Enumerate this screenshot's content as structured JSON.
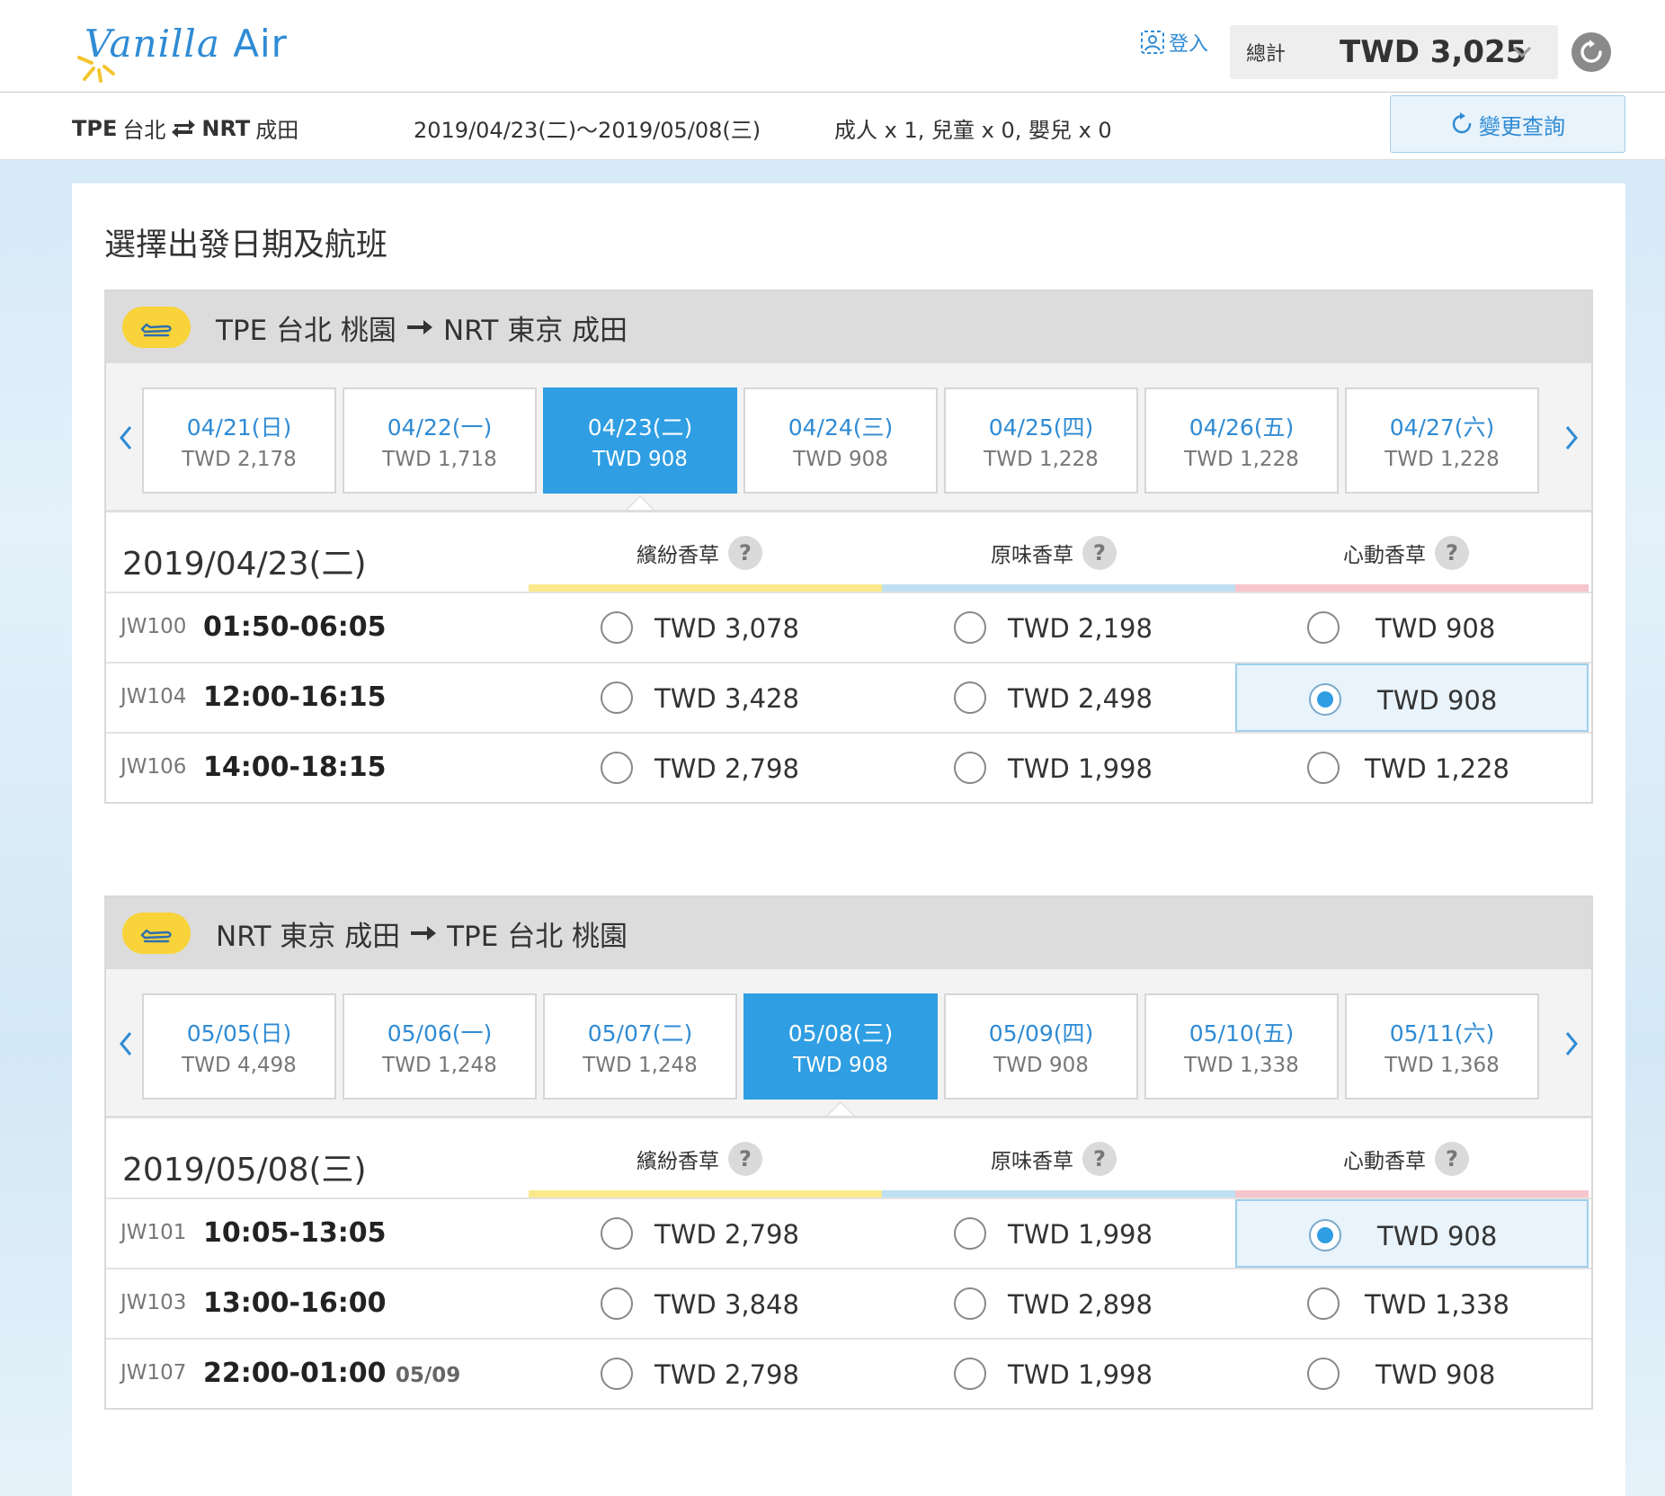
{
  "brand": {
    "name": "Vanilla Air",
    "word": "Vanilla",
    "word2": " Air"
  },
  "header": {
    "login_label": "登入",
    "total_label": "總計",
    "total_value": "TWD 3,025"
  },
  "summary": {
    "origin_code": "TPE",
    "origin_city": "台北",
    "dest_code": "NRT",
    "dest_city": "成田",
    "dates": "2019/04/23(二)～2019/05/08(三)",
    "passengers": "成人 x 1,  兒童 x 0,  嬰兒 x 0",
    "modify_label": "變更查詢"
  },
  "page_title": "選擇出發日期及航班",
  "fare_types": [
    {
      "name": "繽紛香草",
      "color": "#fbe98c"
    },
    {
      "name": "原味香草",
      "color": "#bfe0f2"
    },
    {
      "name": "心動香草",
      "color": "#f7c5cc"
    }
  ],
  "legs": [
    {
      "title_from": "TPE  台北 桃園",
      "title_to": "NRT  東京 成田",
      "selected_date": "2019/04/23(二)",
      "dates": [
        {
          "date": "04/21(日)",
          "price": "TWD 2,178",
          "selected": false
        },
        {
          "date": "04/22(一)",
          "price": "TWD 1,718",
          "selected": false
        },
        {
          "date": "04/23(二)",
          "price": "TWD 908",
          "selected": true
        },
        {
          "date": "04/24(三)",
          "price": "TWD 908",
          "selected": false
        },
        {
          "date": "04/25(四)",
          "price": "TWD 1,228",
          "selected": false
        },
        {
          "date": "04/26(五)",
          "price": "TWD 1,228",
          "selected": false
        },
        {
          "date": "04/27(六)",
          "price": "TWD 1,228",
          "selected": false
        }
      ],
      "flights": [
        {
          "no": "JW100",
          "time": "01:50-06:05",
          "next": "",
          "fares": [
            "TWD 3,078",
            "TWD 2,198",
            "TWD 908"
          ],
          "selected": -1
        },
        {
          "no": "JW104",
          "time": "12:00-16:15",
          "next": "",
          "fares": [
            "TWD 3,428",
            "TWD 2,498",
            "TWD 908"
          ],
          "selected": 2
        },
        {
          "no": "JW106",
          "time": "14:00-18:15",
          "next": "",
          "fares": [
            "TWD 2,798",
            "TWD 1,998",
            "TWD 1,228"
          ],
          "selected": -1
        }
      ]
    },
    {
      "title_from": "NRT  東京 成田",
      "title_to": "TPE  台北 桃園",
      "selected_date": "2019/05/08(三)",
      "dates": [
        {
          "date": "05/05(日)",
          "price": "TWD 4,498",
          "selected": false
        },
        {
          "date": "05/06(一)",
          "price": "TWD 1,248",
          "selected": false
        },
        {
          "date": "05/07(二)",
          "price": "TWD 1,248",
          "selected": false
        },
        {
          "date": "05/08(三)",
          "price": "TWD 908",
          "selected": true
        },
        {
          "date": "05/09(四)",
          "price": "TWD 908",
          "selected": false
        },
        {
          "date": "05/10(五)",
          "price": "TWD 1,338",
          "selected": false
        },
        {
          "date": "05/11(六)",
          "price": "TWD 1,368",
          "selected": false
        }
      ],
      "flights": [
        {
          "no": "JW101",
          "time": "10:05-13:05",
          "next": "",
          "fares": [
            "TWD 2,798",
            "TWD 1,998",
            "TWD 908"
          ],
          "selected": 2
        },
        {
          "no": "JW103",
          "time": "13:00-16:00",
          "next": "",
          "fares": [
            "TWD 3,848",
            "TWD 2,898",
            "TWD 1,338"
          ],
          "selected": -1
        },
        {
          "no": "JW107",
          "time": "22:00-01:00",
          "next": "05/09",
          "fares": [
            "TWD 2,798",
            "TWD 1,998",
            "TWD 908"
          ],
          "selected": -1
        }
      ]
    }
  ]
}
